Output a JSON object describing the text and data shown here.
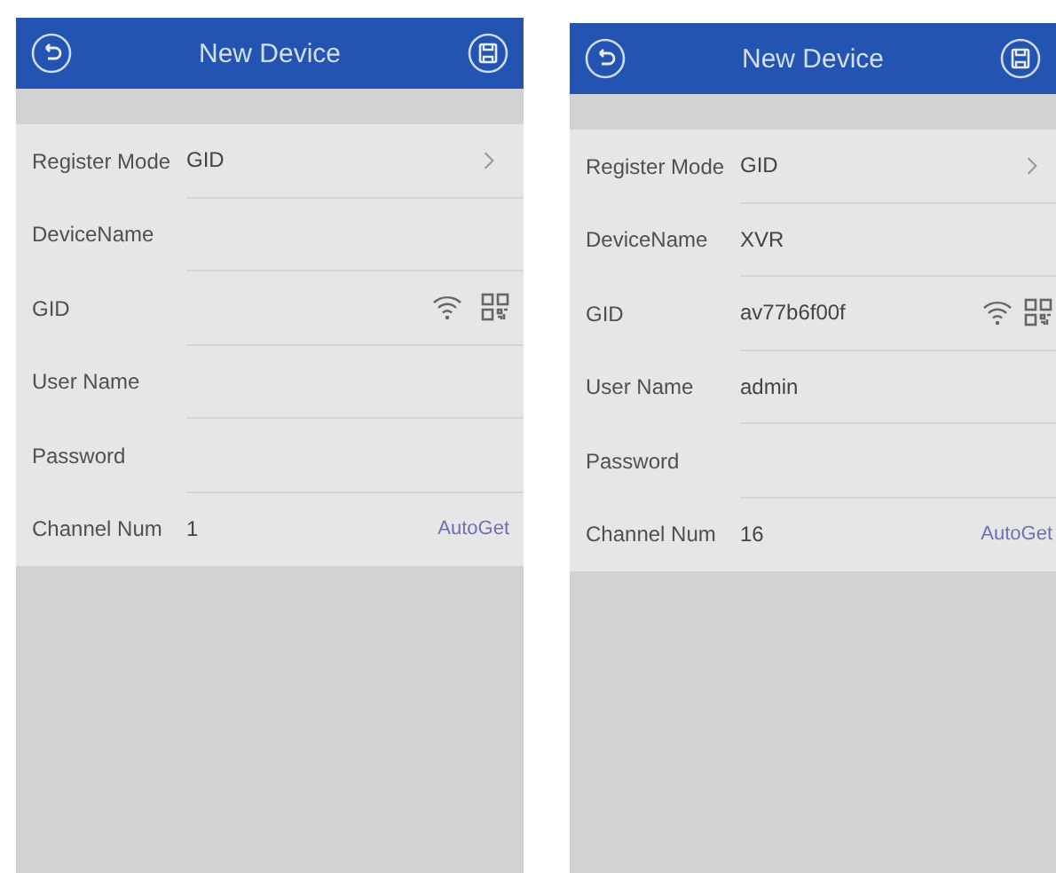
{
  "screens": [
    {
      "title": "New Device",
      "fields": [
        {
          "kind": "select",
          "label": "Register Mode",
          "value": "GID"
        },
        {
          "kind": "text",
          "label": "DeviceName"
        },
        {
          "kind": "gid",
          "label": "GID"
        },
        {
          "kind": "text",
          "label": "User Name"
        },
        {
          "kind": "text",
          "label": "Password"
        },
        {
          "kind": "channel",
          "label": "Channel Num",
          "value": "1",
          "action": "AutoGet"
        }
      ]
    },
    {
      "title": "New Device",
      "fields": [
        {
          "kind": "select",
          "label": "Register Mode",
          "value": "GID"
        },
        {
          "kind": "text",
          "label": "DeviceName",
          "value": "XVR"
        },
        {
          "kind": "gid",
          "label": "GID",
          "value": "av77b6f00f"
        },
        {
          "kind": "text",
          "label": "User Name",
          "value": "admin"
        },
        {
          "kind": "text",
          "label": "Password"
        },
        {
          "kind": "channel",
          "label": "Channel Num",
          "value": "16",
          "action": "AutoGet"
        }
      ]
    }
  ]
}
